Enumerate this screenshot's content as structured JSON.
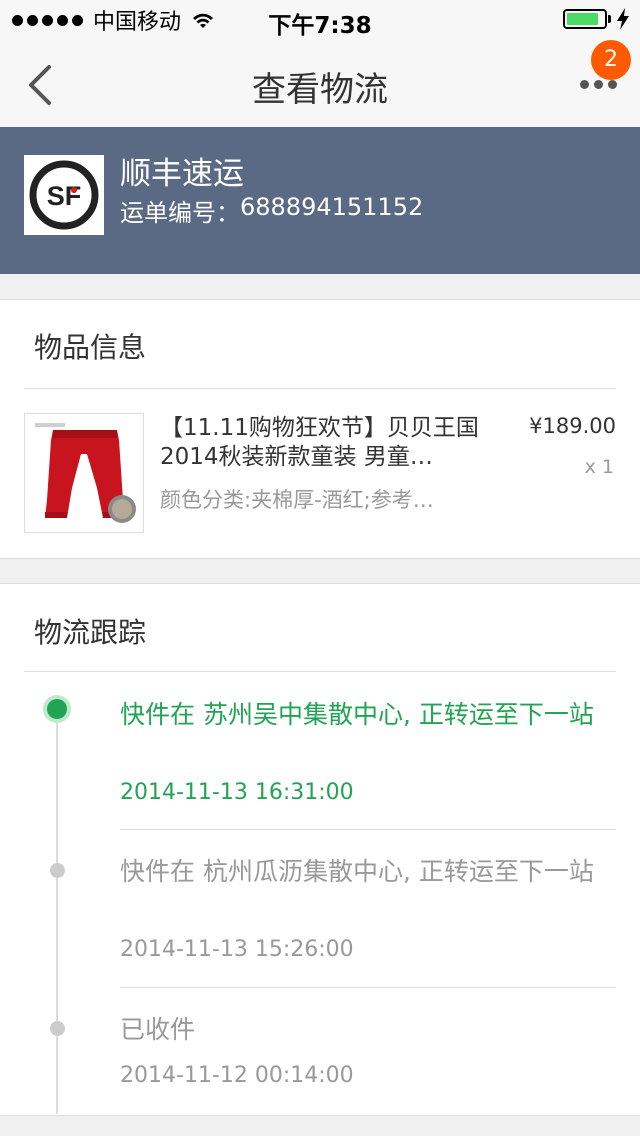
{
  "status_bar": {
    "carrier": "中国移动",
    "time": "下午7:38",
    "battery_level": 0.85
  },
  "nav": {
    "title": "查看物流",
    "badge_count": "2",
    "icons": [
      "chevron-left-icon",
      "more-dots-icon"
    ]
  },
  "carrier_info": {
    "name": "顺丰速运",
    "waybill_label": "运单编号：",
    "waybill_number": "688894151152",
    "logo_text": "SF"
  },
  "goods": {
    "section_title": "物品信息",
    "product": {
      "name": "【11.11购物狂欢节】贝贝王国2014秋装新款童装 男童…",
      "sku": "颜色分类:夹棉厚-酒红;参考…",
      "price": "¥189.00",
      "quantity": "x 1"
    }
  },
  "tracking": {
    "section_title": "物流跟踪",
    "events": [
      {
        "text": "快件在 苏州吴中集散中心, 正转运至下一站",
        "time": "2014-11-13 16:31:00",
        "active": true
      },
      {
        "text": "快件在 杭州瓜沥集散中心, 正转运至下一站",
        "time": "2014-11-13 15:26:00",
        "active": false
      },
      {
        "text": "已收件",
        "time": "2014-11-12 00:14:00",
        "active": false
      }
    ]
  },
  "colors": {
    "header_bg": "#5a6a84",
    "active_green": "#21a454",
    "badge_orange": "#ff5a00"
  }
}
